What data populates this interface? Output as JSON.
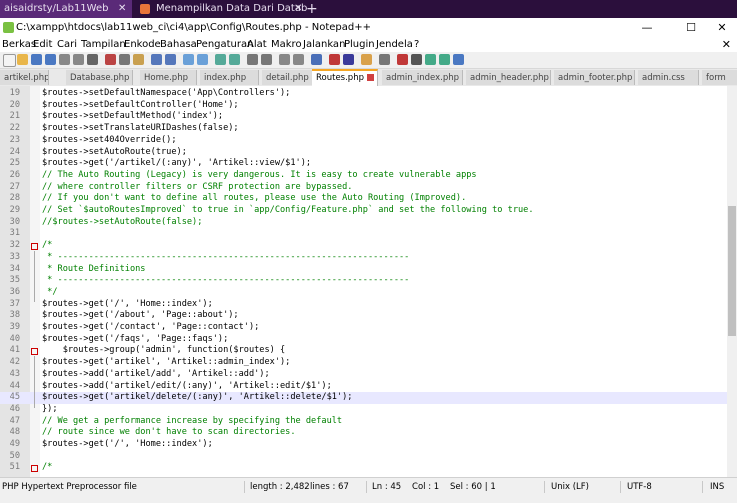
{
  "browser": {
    "tab1": "aisaidrsty/Lab11Web",
    "tab2": "Menampilkan Data Dari Databas",
    "tab_close": "✕",
    "new_tab": "+"
  },
  "window": {
    "title": "C:\\xampp\\htdocs\\lab11web_ci\\ci4\\app\\Config\\Routes.php - Notepad++",
    "minimize": "—",
    "maximize": "☐",
    "close": "✕"
  },
  "menu": {
    "items": [
      "Berkas",
      "Edit",
      "Cari",
      "Tampilan",
      "Enkode",
      "Bahasa",
      "Pengaturan",
      "Alat",
      "Makro",
      "Jalankan",
      "Plugin",
      "Jendela",
      "?"
    ],
    "close": "✕"
  },
  "file_tabs": [
    {
      "label": "artikel.php",
      "active": false
    },
    {
      "label": "Database.php",
      "active": false
    },
    {
      "label": "Home.php",
      "active": false
    },
    {
      "label": "index.php",
      "active": false
    },
    {
      "label": "detail.php",
      "active": false
    },
    {
      "label": "Routes.php",
      "active": true
    },
    {
      "label": "admin_index.php",
      "active": false
    },
    {
      "label": "admin_header.php",
      "active": false
    },
    {
      "label": "admin_footer.php",
      "active": false
    },
    {
      "label": "admin.css",
      "active": false
    },
    {
      "label": "form",
      "active": false
    }
  ],
  "code_lines": [
    {
      "n": "19",
      "text": "$routes->setDefaultNamespace('App\\Controllers');",
      "kind": "code"
    },
    {
      "n": "20",
      "text": "$routes->setDefaultController('Home');",
      "kind": "code"
    },
    {
      "n": "21",
      "text": "$routes->setDefaultMethod('index');",
      "kind": "code"
    },
    {
      "n": "22",
      "text": "$routes->setTranslateURIDashes(false);",
      "kind": "code"
    },
    {
      "n": "23",
      "text": "$routes->set404Override();",
      "kind": "code"
    },
    {
      "n": "24",
      "text": "$routes->setAutoRoute(true);",
      "kind": "code"
    },
    {
      "n": "25",
      "text": "$routes->get('/artikel/(:any)', 'Artikel::view/$1');",
      "kind": "code"
    },
    {
      "n": "26",
      "text": "// The Auto Routing (Legacy) is very dangerous. It is easy to create vulnerable apps",
      "kind": "comment"
    },
    {
      "n": "27",
      "text": "// where controller filters or CSRF protection are bypassed.",
      "kind": "comment"
    },
    {
      "n": "28",
      "text": "// If you don't want to define all routes, please use the Auto Routing (Improved).",
      "kind": "comment"
    },
    {
      "n": "29",
      "text": "// Set `$autoRoutesImproved` to true in `app/Config/Feature.php` and set the following to true.",
      "kind": "comment"
    },
    {
      "n": "30",
      "text": "//$routes->setAutoRoute(false);",
      "kind": "comment"
    },
    {
      "n": "31",
      "text": "",
      "kind": "code"
    },
    {
      "n": "32",
      "text": "/*",
      "kind": "comment"
    },
    {
      "n": "33",
      "text": " * --------------------------------------------------------------------",
      "kind": "comment"
    },
    {
      "n": "34",
      "text": " * Route Definitions",
      "kind": "comment"
    },
    {
      "n": "35",
      "text": " * --------------------------------------------------------------------",
      "kind": "comment"
    },
    {
      "n": "36",
      "text": " */",
      "kind": "comment"
    },
    {
      "n": "37",
      "text": "$routes->get('/', 'Home::index');",
      "kind": "code"
    },
    {
      "n": "38",
      "text": "$routes->get('/about', 'Page::about');",
      "kind": "code"
    },
    {
      "n": "39",
      "text": "$routes->get('/contact', 'Page::contact');",
      "kind": "code"
    },
    {
      "n": "40",
      "text": "$routes->get('/faqs', 'Page::faqs');",
      "kind": "code"
    },
    {
      "n": "41",
      "text": "    $routes->group('admin', function($routes) {",
      "kind": "code"
    },
    {
      "n": "42",
      "text": "$routes->get('artikel', 'Artikel::admin_index');",
      "kind": "code"
    },
    {
      "n": "43",
      "text": "$routes->add('artikel/add', 'Artikel::add');",
      "kind": "code"
    },
    {
      "n": "44",
      "text": "$routes->add('artikel/edit/(:any)', 'Artikel::edit/$1');",
      "kind": "code"
    },
    {
      "n": "45",
      "text": "$routes->get('artikel/delete/(:any)', 'Artikel::delete/$1');",
      "kind": "code",
      "highlight": true
    },
    {
      "n": "46",
      "text": "});",
      "kind": "code"
    },
    {
      "n": "47",
      "text": "// We get a performance increase by specifying the default",
      "kind": "comment"
    },
    {
      "n": "48",
      "text": "// route since we don't have to scan directories.",
      "kind": "comment"
    },
    {
      "n": "49",
      "text": "$routes->get('/', 'Home::index');",
      "kind": "code"
    },
    {
      "n": "50",
      "text": "",
      "kind": "code"
    },
    {
      "n": "51",
      "text": "/*",
      "kind": "comment"
    }
  ],
  "status": {
    "file_type": "PHP Hypertext Preprocessor file",
    "length": "length : 2,482",
    "lines": "lines : 67",
    "position": "Ln : 45    Col : 1    Sel : 60 | 1",
    "eol": "Unix (LF)",
    "encoding": "UTF-8",
    "mode": "INS"
  }
}
